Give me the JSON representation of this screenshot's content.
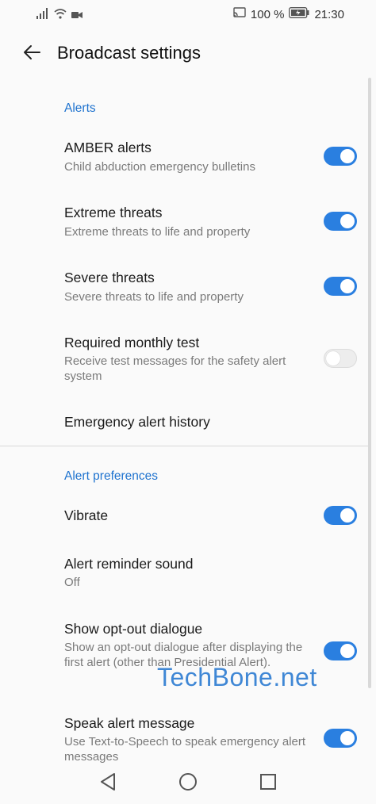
{
  "status_bar": {
    "battery": "100 %",
    "time": "21:30"
  },
  "header": {
    "title": "Broadcast settings"
  },
  "sections": [
    {
      "header": "Alerts",
      "items": [
        {
          "title": "AMBER alerts",
          "subtitle": "Child abduction emergency bulletins",
          "toggle": true
        },
        {
          "title": "Extreme threats",
          "subtitle": "Extreme threats to life and property",
          "toggle": true
        },
        {
          "title": "Severe threats",
          "subtitle": "Severe threats to life and property",
          "toggle": true
        },
        {
          "title": "Required monthly test",
          "subtitle": "Receive test messages for the safety alert system",
          "toggle": false
        },
        {
          "title": "Emergency alert history"
        }
      ]
    },
    {
      "header": "Alert preferences",
      "items": [
        {
          "title": "Vibrate",
          "toggle": true
        },
        {
          "title": "Alert reminder sound",
          "subtitle": "Off"
        },
        {
          "title": "Show opt-out dialogue",
          "subtitle": "Show an opt-out dialogue after displaying the first alert (other than Presidential Alert).",
          "toggle": true
        },
        {
          "title": "Speak alert message",
          "subtitle": "Use Text-to-Speech to speak emergency alert messages",
          "toggle": true
        }
      ]
    }
  ],
  "watermark": "TechBone.net",
  "colors": {
    "accent": "#2a7fe0",
    "section_header": "#1f73cf",
    "background": "#fafafa"
  }
}
